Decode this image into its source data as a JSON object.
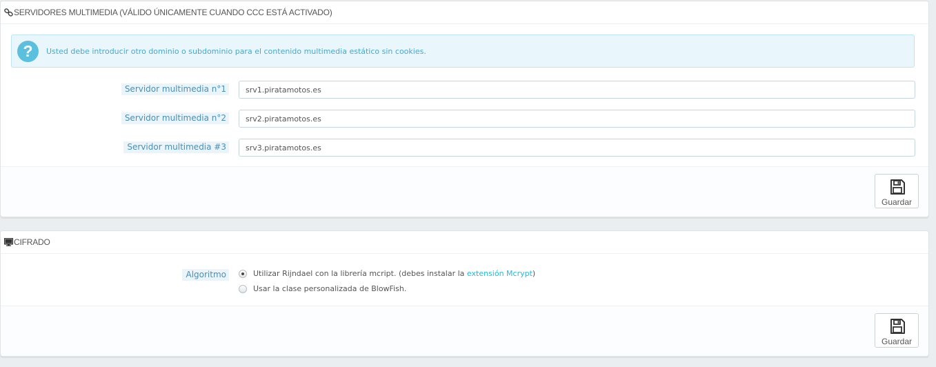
{
  "media_servers": {
    "heading": "SERVIDORES MULTIMEDIA (VÁLIDO ÚNICAMENTE CUANDO CCC ESTÁ ACTIVADO)",
    "heading_icon": "link-icon",
    "alert_text": "Usted debe introducir otro dominio o subdominio para el contenido multimedia estático sin cookies.",
    "alert_icon": "question-circle-icon",
    "fields": [
      {
        "label": "Servidor multimedia n°1",
        "value": "srv1.piratamotos.es"
      },
      {
        "label": "Servidor multimedia n°2",
        "value": "srv2.piratamotos.es"
      },
      {
        "label": "Servidor multimedia #3",
        "value": "srv3.piratamotos.es"
      }
    ],
    "save_label": "Guardar"
  },
  "cipher": {
    "heading": "CIFRADO",
    "heading_icon": "monitor-icon",
    "field_label": "Algoritmo",
    "options": [
      {
        "text_before": "Utilizar Rijndael con la librería mcript. (debes instalar la ",
        "link_text": "extensión Mcrypt",
        "text_after": ")",
        "checked": true
      },
      {
        "text": "Usar la clase personalizada de BlowFish.",
        "checked": false
      }
    ],
    "save_label": "Guardar"
  },
  "colors": {
    "accent": "#25b9d7",
    "alert_bg": "#e9f6fb",
    "alert_icon": "#5bc0de",
    "label_bg": "#eaf4f9"
  }
}
